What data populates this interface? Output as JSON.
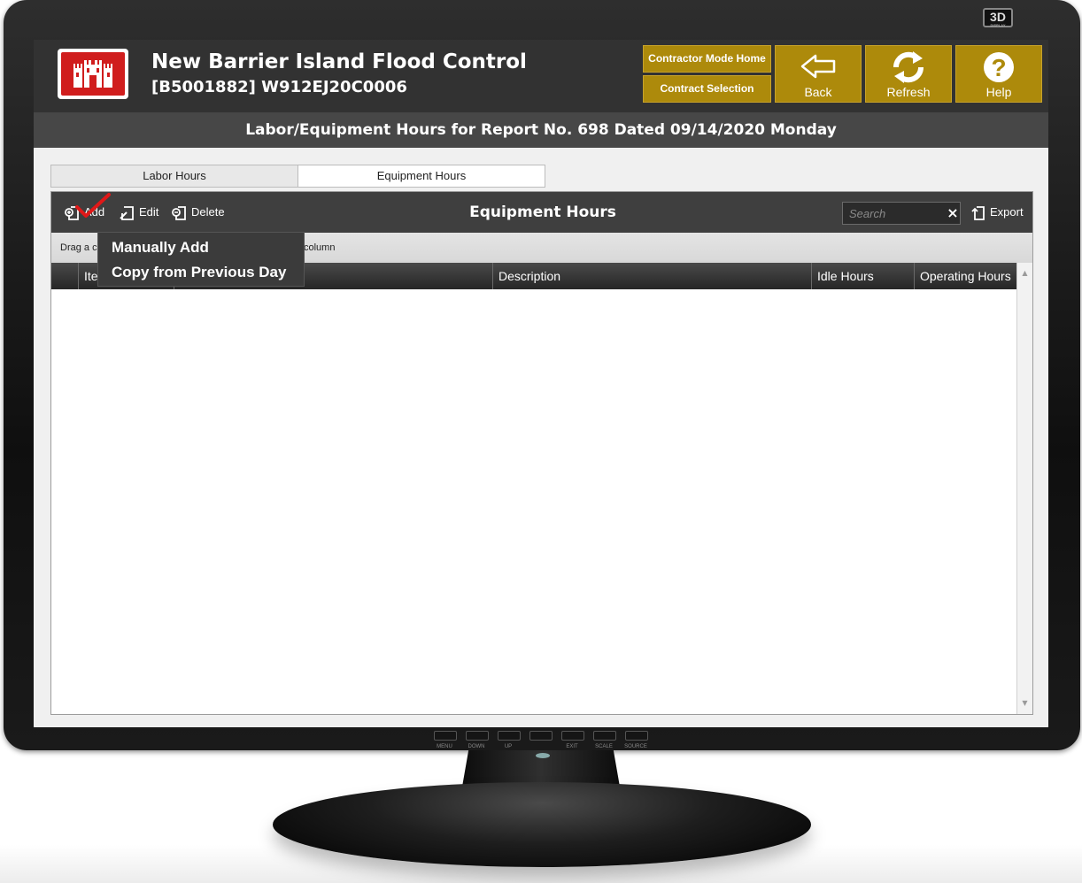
{
  "header": {
    "project_title": "New Barrier Island Flood Control",
    "project_subtitle": "[B5001882] W912EJ20C0006",
    "nav": {
      "contractor_mode_home": "Contractor Mode Home",
      "contract_selection": "Contract Selection",
      "back": "Back",
      "refresh": "Refresh",
      "help": "Help"
    }
  },
  "page_title": "Labor/Equipment Hours for Report No. 698 Dated 09/14/2020 Monday",
  "tabs": [
    {
      "label": "Labor Hours",
      "active": false
    },
    {
      "label": "Equipment Hours",
      "active": true
    }
  ],
  "toolbar": {
    "add_label": "Add",
    "edit_label": "Edit",
    "delete_label": "Delete",
    "title": "Equipment Hours",
    "search_placeholder": "Search",
    "clear_label": "×",
    "export_label": "Export"
  },
  "group_bar": {
    "text_left": "Drag a c",
    "text_right": "column"
  },
  "grid": {
    "columns": [
      "Ite",
      "Description",
      "Idle Hours",
      "Operating Hours"
    ],
    "rows": []
  },
  "add_menu": {
    "items": [
      "Manually Add",
      "Copy from Previous Day"
    ]
  },
  "monitor": {
    "badge": "3D",
    "badge_sub": "DISPLAY",
    "buttons": [
      "MENU",
      "DOWN",
      "UP",
      "",
      "EXIT",
      "SCALE",
      "SOURCE"
    ]
  },
  "colors": {
    "accent_gold": "#ad8a0b",
    "logo_red": "#d01d1d",
    "header_dark": "#323232"
  }
}
